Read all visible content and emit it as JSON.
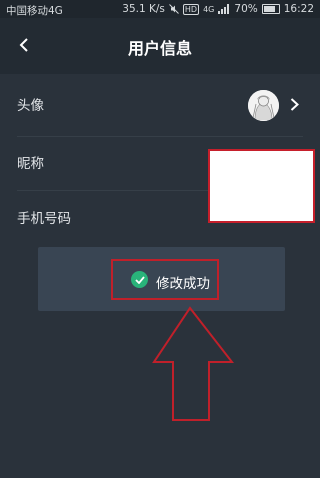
{
  "status": {
    "carrier": "中国移动4G",
    "speed": "35.1 K/s",
    "hd": "HD",
    "network": "4G",
    "battery": "70%",
    "time": "16:22"
  },
  "header": {
    "title": "用户信息"
  },
  "rows": [
    {
      "label": "头像"
    },
    {
      "label": "昵称"
    },
    {
      "label": "手机号码"
    }
  ],
  "toast": {
    "message": "修改成功"
  },
  "colors": {
    "accent": "#29b37a",
    "highlight": "#c61f2b"
  }
}
